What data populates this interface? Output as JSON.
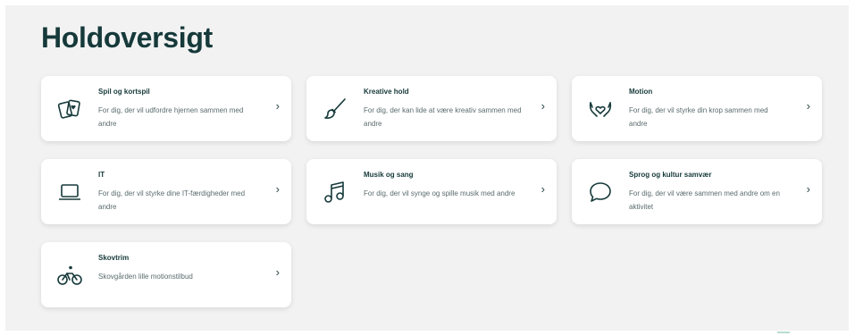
{
  "page": {
    "title": "Holdoversigt"
  },
  "cards": [
    {
      "title": "Spil og kortspil",
      "description": "For dig, der vil udfordre hjernen sammen med andre",
      "icon": "playing-cards-icon"
    },
    {
      "title": "Kreative hold",
      "description": "For dig, der kan lide at være kreativ sammen med andre",
      "icon": "paintbrush-icon"
    },
    {
      "title": "Motion",
      "description": "For dig, der vil styrke din krop sammen med andre",
      "icon": "hands-heart-icon"
    },
    {
      "title": "IT",
      "description": "For dig, der vil styrke dine IT-færdigheder med andre",
      "icon": "laptop-icon"
    },
    {
      "title": "Musik og sang",
      "description": "For dig, der vil synge og spille musik med andre",
      "icon": "music-note-icon"
    },
    {
      "title": "Sprog og kultur samvær",
      "description": "For dig, der vil være sammen med andre om en aktivitet",
      "icon": "speech-bubble-icon"
    },
    {
      "title": "Skovtrim",
      "description": "Skovgården lille motionstilbud",
      "icon": "bicycle-rider-icon"
    }
  ],
  "chevron_glyph": "›",
  "colors": {
    "heading": "#16393a",
    "body_text": "#5a6b6c",
    "panel_background": "#f2f2f2",
    "card_background": "#ffffff"
  }
}
